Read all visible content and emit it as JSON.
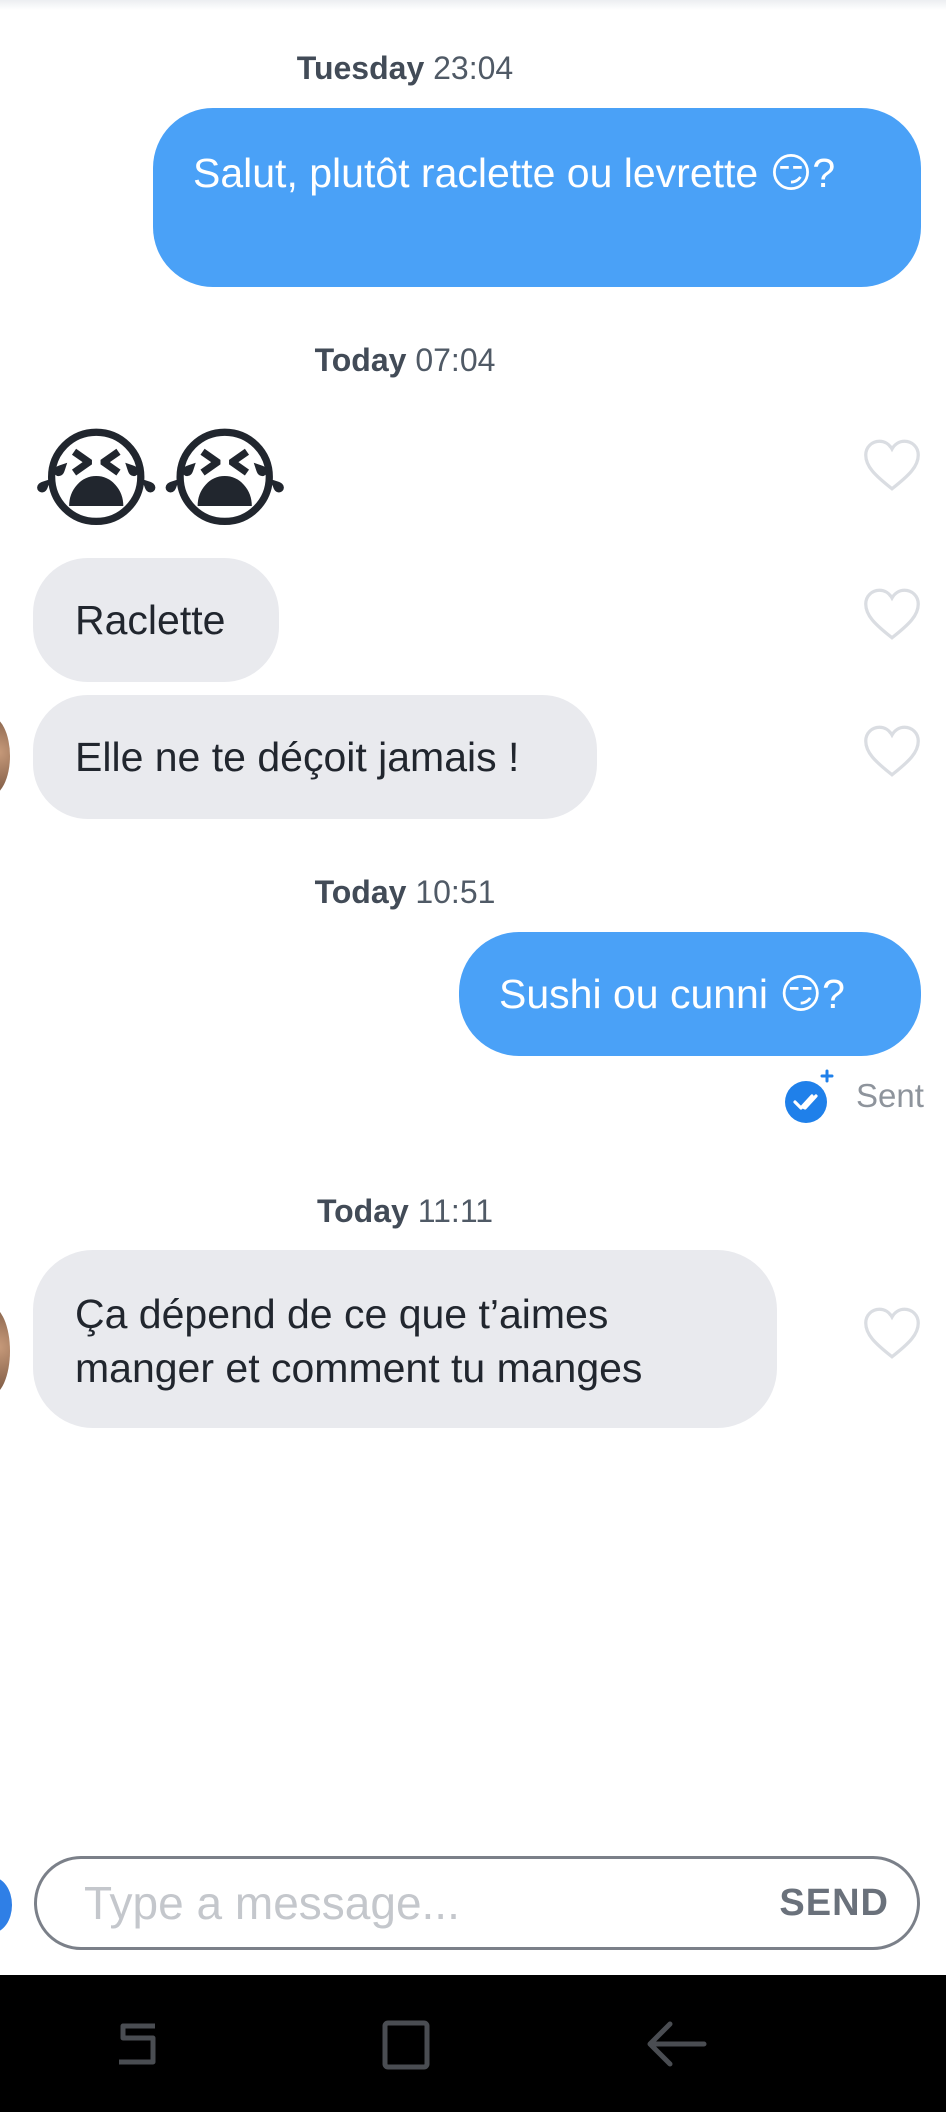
{
  "conversation": {
    "groups": [
      {
        "day": "Tuesday",
        "time": "23:04"
      },
      {
        "day": "Today",
        "time": "07:04"
      },
      {
        "day": "Today",
        "time": "10:51"
      },
      {
        "day": "Today",
        "time": "11:11"
      }
    ],
    "messages": [
      {
        "from": "me",
        "text": "Salut, plutôt raclette ou levrette 😏?"
      },
      {
        "from": "them",
        "text": "😭😭"
      },
      {
        "from": "them",
        "text": "Raclette"
      },
      {
        "from": "them",
        "text": "Elle ne te déçoit jamais !"
      },
      {
        "from": "me",
        "text": "Sushi ou cunni 😏?"
      },
      {
        "from": "them",
        "text": "Ça dépend de ce que t’aimes manger et comment tu manges"
      }
    ],
    "sent_status": "Sent"
  },
  "composer": {
    "placeholder": "Type a message...",
    "send_label": "SEND"
  },
  "icons": {
    "like": "heart-outline-icon",
    "read": "double-check-icon",
    "nav": [
      "recent-apps-icon",
      "home-icon",
      "back-icon"
    ]
  },
  "colors": {
    "outgoing_bubble": "#4aa1f7",
    "incoming_bubble": "#e9eaee",
    "read_badge": "#1f80ea"
  }
}
